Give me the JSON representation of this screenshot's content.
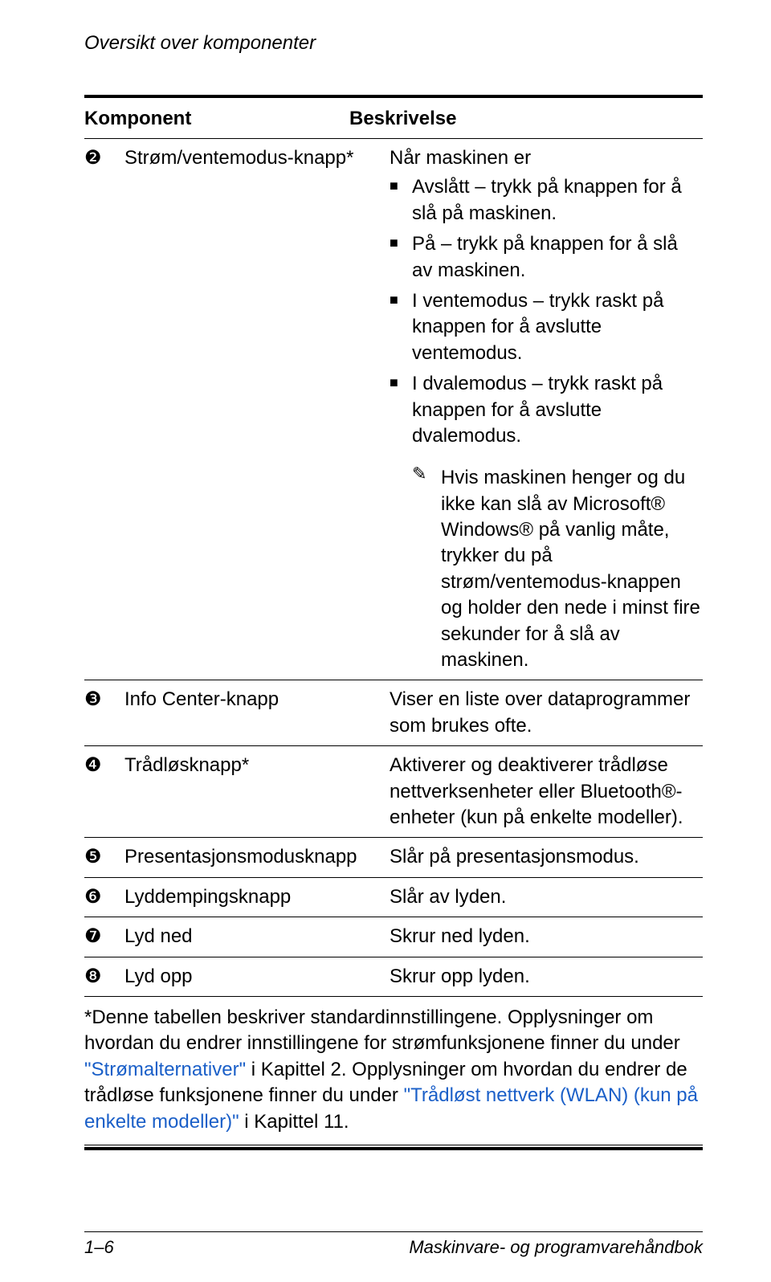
{
  "runningHead": "Oversikt over komponenter",
  "tableHeader": {
    "component": "Komponent",
    "description": "Beskrivelse"
  },
  "rows": {
    "r2": {
      "num": "❷",
      "name": "Strøm/ventemodus-knapp*",
      "intro": "Når maskinen er",
      "bullets": [
        "Avslått – trykk på knappen for å slå på maskinen.",
        "På – trykk på knappen for å slå av maskinen.",
        "I ventemodus – trykk raskt på knappen for å avslutte ventemodus.",
        "I dvalemodus – trykk raskt på knappen for å avslutte dvalemodus."
      ],
      "noteIcon": "✎",
      "note": "Hvis maskinen henger og du ikke kan slå av Microsoft® Windows® på vanlig måte, trykker du på strøm/ventemodus-knappen og holder den nede i minst fire sekunder for å slå av maskinen."
    },
    "r3": {
      "num": "❸",
      "name": "Info Center-knapp",
      "desc": "Viser en liste over dataprogrammer som brukes ofte."
    },
    "r4": {
      "num": "❹",
      "name": "Trådløsknapp*",
      "desc": "Aktiverer og deaktiverer trådløse nettverksenheter eller Bluetooth®-enheter (kun på enkelte modeller)."
    },
    "r5": {
      "num": "❺",
      "name": "Presentasjonsmodusknapp",
      "desc": "Slår på presentasjonsmodus."
    },
    "r6": {
      "num": "❻",
      "name": "Lyddempingsknapp",
      "desc": "Slår av lyden."
    },
    "r7": {
      "num": "❼",
      "name": "Lyd ned",
      "desc": "Skrur ned lyden."
    },
    "r8": {
      "num": "❽",
      "name": "Lyd opp",
      "desc": "Skrur opp lyden."
    }
  },
  "footnote": {
    "t1": "*Denne tabellen beskriver standardinnstillingene. Opplysninger om hvordan du endrer innstillingene for strømfunksjonene finner du under ",
    "link1": "\"Strømalternativer\"",
    "t2": " i Kapittel 2. Opplysninger om hvordan du endrer de trådløse funksjonene finner du under ",
    "link2": "\"Trådløst nettverk (WLAN) (kun på enkelte modeller)\"",
    "t3": " i Kapittel 11."
  },
  "footer": {
    "left": "1–6",
    "right": "Maskinvare- og programvarehåndbok"
  }
}
